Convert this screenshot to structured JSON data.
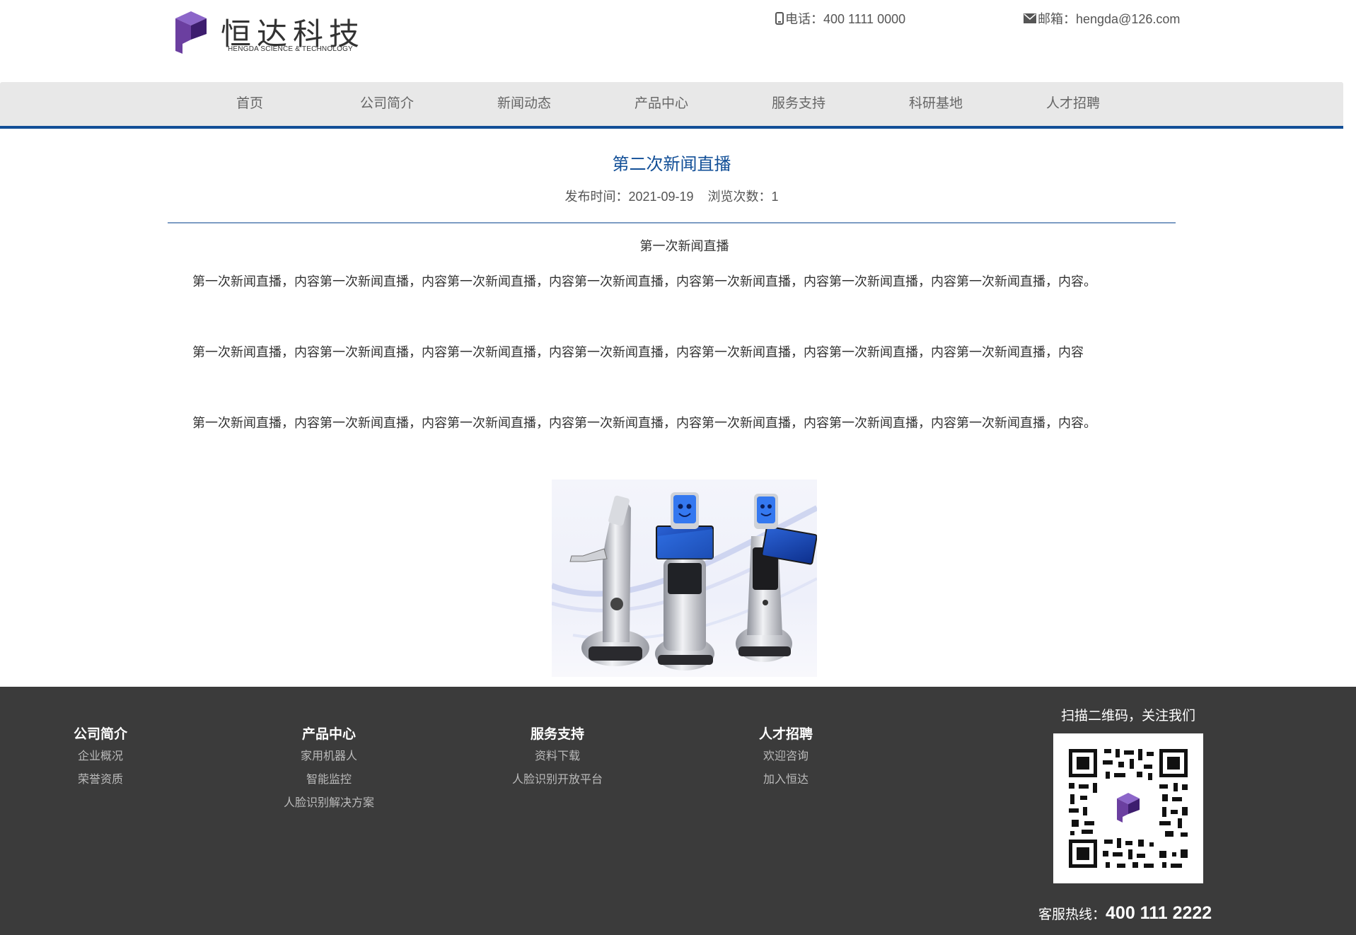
{
  "header": {
    "logo_cn": "恒达科技",
    "logo_en": "HENGDA SCIENCE & TECHNOLOGY",
    "phone": "电话：400 1111 0000",
    "email": "邮箱：hengda@126.com"
  },
  "nav": {
    "items": [
      {
        "label": "首页"
      },
      {
        "label": "公司简介"
      },
      {
        "label": "新闻动态"
      },
      {
        "label": "产品中心"
      },
      {
        "label": "服务支持"
      },
      {
        "label": "科研基地"
      },
      {
        "label": "人才招聘"
      }
    ]
  },
  "article": {
    "title": "第二次新闻直播",
    "meta": "发布时间：2021-09-19    浏览次数：1",
    "sub_heading": "第一次新闻直播",
    "paragraphs": [
      "第一次新闻直播，内容第一次新闻直播，内容第一次新闻直播，内容第一次新闻直播，内容第一次新闻直播，内容第一次新闻直播，内容第一次新闻直播，内容。",
      "第一次新闻直播，内容第一次新闻直播，内容第一次新闻直播，内容第一次新闻直播，内容第一次新闻直播，内容第一次新闻直播，内容第一次新闻直播，内容",
      "第一次新闻直播，内容第一次新闻直播，内容第一次新闻直播，内容第一次新闻直播，内容第一次新闻直播，内容第一次新闻直播，内容第一次新闻直播，内容。"
    ]
  },
  "footer": {
    "columns": [
      {
        "heading": "公司简介",
        "links": [
          "企业概况",
          "荣誉资质"
        ]
      },
      {
        "heading": "产品中心",
        "links": [
          "家用机器人",
          "智能监控",
          "人脸识别解决方案"
        ]
      },
      {
        "heading": "服务支持",
        "links": [
          "资料下载",
          "人脸识别开放平台"
        ]
      },
      {
        "heading": "人才招聘",
        "links": [
          "欢迎咨询",
          "加入恒达"
        ]
      }
    ],
    "qr_caption": "扫描二维码，关注我们",
    "hotline_label": "客服热线：",
    "hotline_number": "400 111 2222"
  },
  "colors": {
    "brand_blue": "#124f97",
    "logo_purple": "#6b3fa0",
    "footer_bg": "#3b3b3b",
    "nav_bg": "#e8e8e8"
  },
  "icons": [
    "phone-icon",
    "mail-icon",
    "logo-mark-icon",
    "qr-code"
  ]
}
